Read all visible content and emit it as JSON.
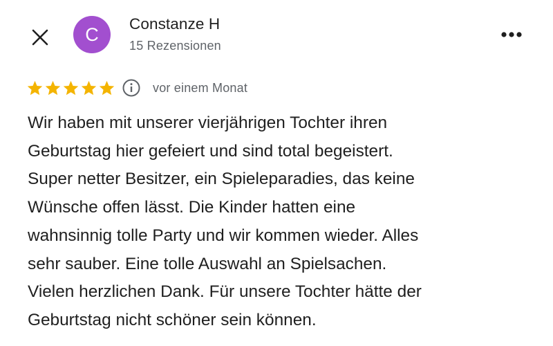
{
  "review": {
    "author": {
      "name": "Constanze H",
      "initial": "C",
      "avatar_color": "#a24fcf",
      "review_count_label": "15 Rezensionen"
    },
    "rating": {
      "stars": 5,
      "max_stars": 5,
      "star_color": "#f4b400",
      "info_icon": "info-icon"
    },
    "date_label": "vor einem Monat",
    "text": "Wir haben mit unserer vierjährigen Tochter ihren\nGeburtstag hier gefeiert und sind total begeistert.\nSuper netter Besitzer, ein Spieleparadies, das keine\nWünsche offen lässt. Die Kinder hatten eine\nwahnsinnig tolle Party und wir kommen wieder. Alles\nsehr sauber. Eine tolle Auswahl an Spielsachen.\nVielen herzlichen Dank. Für unsere Tochter hätte der\nGeburtstag nicht schöner sein können."
  },
  "toolbar": {
    "close_icon": "close-icon",
    "more_icon": "more-options-icon"
  },
  "colors": {
    "text_primary": "#1f1f1f",
    "text_secondary": "#5f6368",
    "background": "#ffffff"
  }
}
